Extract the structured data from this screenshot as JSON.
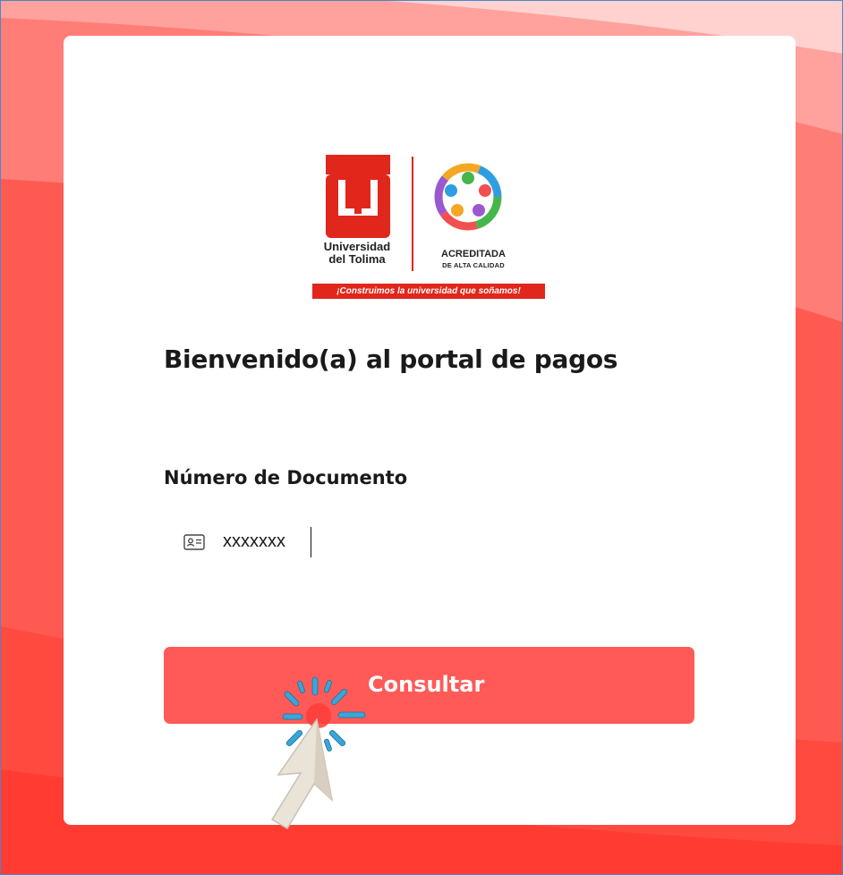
{
  "colors": {
    "background": "#ff5a52",
    "card": "#ffffff",
    "button": "#ff5a57",
    "brand_red": "#e1261c",
    "click_highlight": "#3aa6d8"
  },
  "logo": {
    "university_line1": "Universidad",
    "university_line2": "del Tolima",
    "accreditation": "ACREDITADA",
    "accreditation_sub": "DE ALTA CALIDAD",
    "slogan": "¡Construimos la universidad que soñamos!"
  },
  "title": "Bienvenido(a) al portal de pagos",
  "form": {
    "document_label": "Número de Documento",
    "document_value": "xxxxxxx",
    "submit_label": "Consultar"
  },
  "icons": {
    "id_card": "id-card-icon",
    "cursor": "mouse-pointer-icon",
    "click": "click-burst-icon"
  }
}
